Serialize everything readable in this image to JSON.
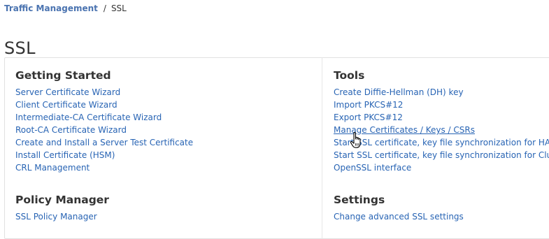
{
  "breadcrumb": {
    "parent": "Traffic Management",
    "separator": "/",
    "current": "SSL"
  },
  "page_title": "SSL",
  "sections": {
    "getting_started": {
      "title": "Getting Started",
      "links": [
        "Server Certificate Wizard",
        "Client Certificate Wizard",
        "Intermediate-CA Certificate Wizard",
        "Root-CA Certificate Wizard",
        "Create and Install a Server Test Certificate",
        "Install Certificate (HSM)",
        "CRL Management"
      ]
    },
    "tools": {
      "title": "Tools",
      "links": [
        "Create Diffie-Hellman (DH) key",
        "Import PKCS#12",
        "Export PKCS#12",
        "Manage Certificates / Keys / CSRs",
        "Start SSL certificate, key file synchronization for HA",
        "Start SSL certificate, key file synchronization for Cluster",
        "OpenSSL interface"
      ]
    },
    "policy_manager": {
      "title": "Policy Manager",
      "links": [
        "SSL Policy Manager"
      ]
    },
    "settings": {
      "title": "Settings",
      "links": [
        "Change advanced SSL settings"
      ]
    }
  },
  "icons": {
    "cursor": "hand-pointer-cursor-icon"
  },
  "colors": {
    "link": "#2864b4",
    "breadcrumb_link": "#4a73b0",
    "text": "#333333",
    "border": "#e1e1e1"
  }
}
